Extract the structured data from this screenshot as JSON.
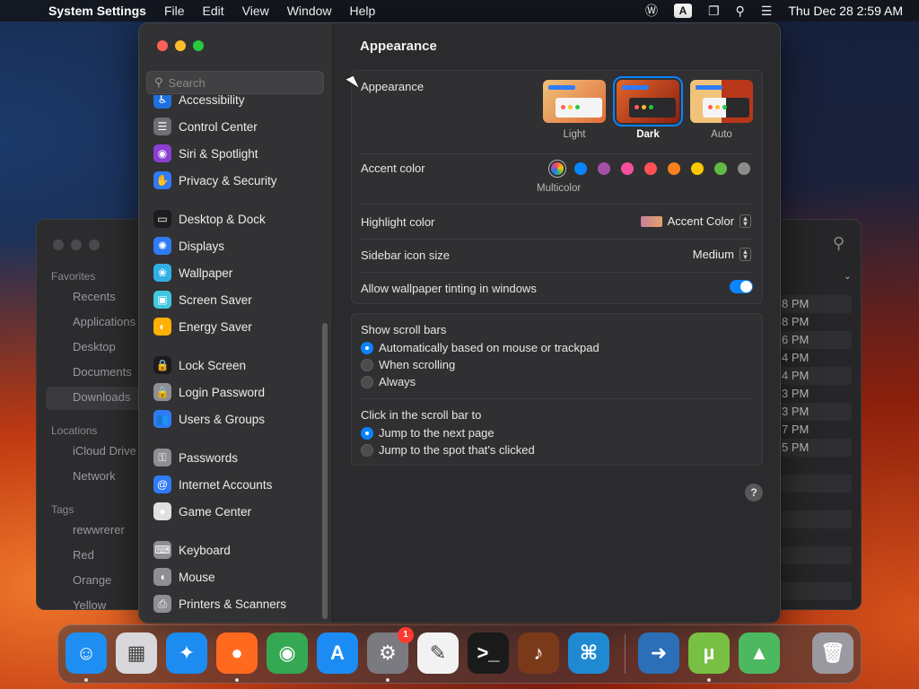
{
  "menubar": {
    "app_name": "System Settings",
    "menus": [
      "File",
      "Edit",
      "View",
      "Window",
      "Help"
    ],
    "input_source": "A",
    "datetime": "Thu Dec 28  2:59 AM"
  },
  "finder": {
    "favorites_heading": "Favorites",
    "favorites": [
      "Recents",
      "Applications",
      "Desktop",
      "Documents",
      "Downloads"
    ],
    "locations_heading": "Locations",
    "locations": [
      "iCloud Drive",
      "Network"
    ],
    "tags_heading": "Tags",
    "tags": [
      "rewwrerer",
      "Red",
      "Orange",
      "Yellow"
    ],
    "times": [
      "8 PM",
      "8 PM",
      "6 PM",
      "4 PM",
      "4 PM",
      "3 PM",
      "3 PM",
      "7 PM",
      "5 PM"
    ]
  },
  "sidebar": {
    "search_placeholder": "Search",
    "items": [
      {
        "label": "Accessibility",
        "icon": "accessibility-icon",
        "color": "#1e6fe0"
      },
      {
        "label": "Control Center",
        "icon": "control-center-icon",
        "color": "#6e6e73"
      },
      {
        "label": "Siri & Spotlight",
        "icon": "siri-icon",
        "color": "#8a3fd1"
      },
      {
        "label": "Privacy & Security",
        "icon": "hand-icon",
        "color": "#2f7bf5"
      },
      {
        "label": "Desktop & Dock",
        "icon": "desktop-dock-icon",
        "color": "#1c1c1e"
      },
      {
        "label": "Displays",
        "icon": "displays-icon",
        "color": "#2f7bf5"
      },
      {
        "label": "Wallpaper",
        "icon": "wallpaper-icon",
        "color": "#30b0e6"
      },
      {
        "label": "Screen Saver",
        "icon": "screen-saver-icon",
        "color": "#40c8e0"
      },
      {
        "label": "Energy Saver",
        "icon": "energy-icon",
        "color": "#ffb000"
      },
      {
        "label": "Lock Screen",
        "icon": "lock-icon",
        "color": "#1c1c1e"
      },
      {
        "label": "Login Password",
        "icon": "lock-key-icon",
        "color": "#8e8e93"
      },
      {
        "label": "Users & Groups",
        "icon": "users-icon",
        "color": "#2f7bf5"
      },
      {
        "label": "Passwords",
        "icon": "key-icon",
        "color": "#8e8e93"
      },
      {
        "label": "Internet Accounts",
        "icon": "at-icon",
        "color": "#2f7bf5"
      },
      {
        "label": "Game Center",
        "icon": "game-center-icon",
        "color": "#e0e0e0"
      },
      {
        "label": "Keyboard",
        "icon": "keyboard-icon",
        "color": "#8e8e93"
      },
      {
        "label": "Mouse",
        "icon": "mouse-icon",
        "color": "#8e8e93"
      },
      {
        "label": "Printers & Scanners",
        "icon": "printer-icon",
        "color": "#8e8e93"
      }
    ]
  },
  "main": {
    "title": "Appearance",
    "appearance_label": "Appearance",
    "themes": [
      {
        "label": "Light",
        "selected": false
      },
      {
        "label": "Dark",
        "selected": true
      },
      {
        "label": "Auto",
        "selected": false
      }
    ],
    "accent_label": "Accent color",
    "accent_colors": [
      "multicolor",
      "#0a84ff",
      "#a550a7",
      "#f74f9e",
      "#ff5257",
      "#f7821b",
      "#ffc600",
      "#62ba46",
      "#8c8c8c"
    ],
    "accent_selected_label": "Multicolor",
    "highlight_label": "Highlight color",
    "highlight_value": "Accent Color",
    "icon_size_label": "Sidebar icon size",
    "icon_size_value": "Medium",
    "tinting_label": "Allow wallpaper tinting in windows",
    "tinting_on": true,
    "scroll_heading": "Show scroll bars",
    "scroll_options": [
      "Automatically based on mouse or trackpad",
      "When scrolling",
      "Always"
    ],
    "click_heading": "Click in the scroll bar to",
    "click_options": [
      "Jump to the next page",
      "Jump to the spot that's clicked"
    ],
    "help": "?"
  },
  "dock": {
    "apps": [
      {
        "name": "finder",
        "glyph": "☺",
        "color": "#1e8ef2",
        "running": true
      },
      {
        "name": "launchpad",
        "glyph": "▦",
        "color": "#d8d8dc",
        "running": false
      },
      {
        "name": "safari",
        "glyph": "✦",
        "color": "#1c8cf0",
        "running": false
      },
      {
        "name": "firefox",
        "glyph": "●",
        "color": "#ff6a1f",
        "running": true
      },
      {
        "name": "chrome",
        "glyph": "◉",
        "color": "#34a853",
        "running": false
      },
      {
        "name": "app-store",
        "glyph": "A",
        "color": "#1a8cf4",
        "running": false
      },
      {
        "name": "system-settings",
        "glyph": "⚙",
        "color": "#7a7a80",
        "running": true
      },
      {
        "name": "textedit",
        "glyph": "✎",
        "color": "#f2f2f2",
        "running": false
      },
      {
        "name": "terminal",
        "glyph": ">_",
        "color": "#1a1a1a",
        "running": false
      },
      {
        "name": "garageband",
        "glyph": "♪",
        "color": "#7a3a1a",
        "running": false
      },
      {
        "name": "vscode",
        "glyph": "⌘",
        "color": "#1f8ad2",
        "running": false
      },
      {
        "name": "migration",
        "glyph": "➜",
        "color": "#2b6fb8",
        "running": false
      },
      {
        "name": "utorrent",
        "glyph": "µ",
        "color": "#78c044",
        "running": true
      },
      {
        "name": "maps",
        "glyph": "▲",
        "color": "#4cb860",
        "running": false
      },
      {
        "name": "trash",
        "glyph": "🗑",
        "color": "#9a9aa0",
        "running": false
      }
    ],
    "settings_badge": "1"
  }
}
